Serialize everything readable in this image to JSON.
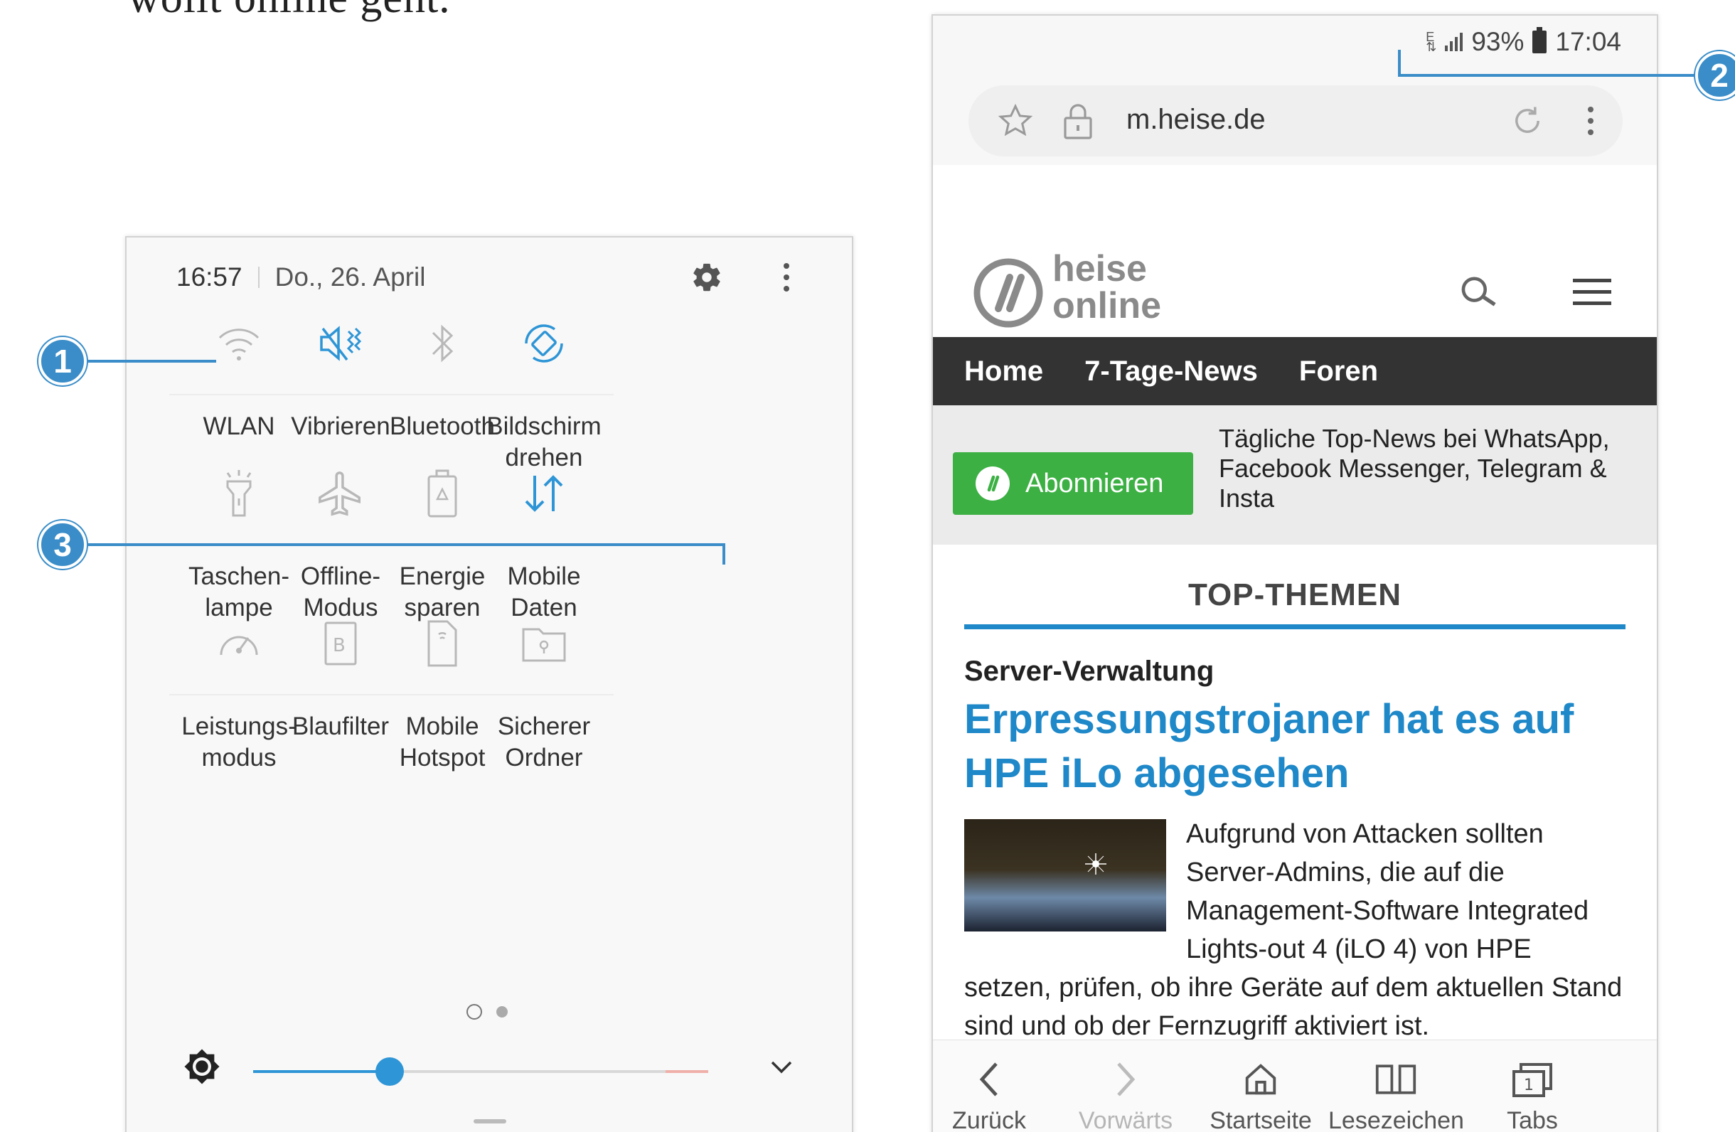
{
  "book_text": "wollt online geht.",
  "quick_panel": {
    "time": "16:57",
    "date": "Do., 26. April",
    "tiles": [
      {
        "label": "WLAN",
        "icon": "wifi-icon",
        "active": false
      },
      {
        "label": "Vibrieren",
        "icon": "vibrate-icon",
        "active": true
      },
      {
        "label": "Bluetooth",
        "icon": "bluetooth-icon",
        "active": false
      },
      {
        "label": "Bildschirm\ndrehen",
        "icon": "rotate-screen-icon",
        "active": true
      },
      {
        "label": "Taschen-\nlampe",
        "icon": "flashlight-icon",
        "active": false
      },
      {
        "label": "Offline-\nModus",
        "icon": "airplane-icon",
        "active": false
      },
      {
        "label": "Energie\nsparen",
        "icon": "battery-saver-icon",
        "active": false
      },
      {
        "label": "Mobile\nDaten",
        "icon": "mobile-data-icon",
        "active": true
      },
      {
        "label": "Leistungs-\nmodus",
        "icon": "performance-mode-icon",
        "active": false
      },
      {
        "label": "Blaufilter",
        "icon": "blue-light-filter-icon",
        "active": false
      },
      {
        "label": "Mobile\nHotspot",
        "icon": "hotspot-icon",
        "active": false
      },
      {
        "label": "Sicherer\nOrdner",
        "icon": "secure-folder-icon",
        "active": false
      }
    ],
    "page_indicator": {
      "pages": 2,
      "current": 1
    },
    "brightness_level": 0.3
  },
  "callouts": [
    "1",
    "2",
    "3"
  ],
  "browser": {
    "status": {
      "battery": "93%",
      "time": "17:04"
    },
    "url": "m.heise.de",
    "logo_line1": "heise",
    "logo_line2": "online",
    "nav": [
      "Home",
      "7-Tage-News",
      "Foren"
    ],
    "promo_button": "Abonnieren",
    "promo_text": "Tägliche Top-News bei WhatsApp, Facebook Messenger, Telegram & Insta",
    "section_title": "TOP-THEMEN",
    "kicker": "Server-Verwaltung",
    "headline": "Erpressungstrojaner hat es auf HPE iLo abgesehen",
    "teaser": "Aufgrund von Attacken sollten Server-Admins, die auf die Management-Software Integrated Lights-out 4 (iLO 4) von HPE setzen, prüfen, ob ihre Geräte auf dem aktuellen Stand sind und ob der Fernzugriff aktiviert ist.",
    "bottom_nav": [
      {
        "label": "Zurück",
        "icon": "back-icon",
        "enabled": true
      },
      {
        "label": "Vorwärts",
        "icon": "forward-icon",
        "enabled": false
      },
      {
        "label": "Startseite",
        "icon": "home-icon",
        "enabled": true
      },
      {
        "label": "Lesezeichen",
        "icon": "bookmarks-icon",
        "enabled": true
      },
      {
        "label": "Tabs",
        "icon": "tabs-icon",
        "enabled": true
      }
    ]
  },
  "colors": {
    "accent": "#2e95d6",
    "callout": "#3a8dc8",
    "heise_blue": "#1e88c8",
    "promo_green": "#3cb043",
    "navbar": "#333333"
  }
}
